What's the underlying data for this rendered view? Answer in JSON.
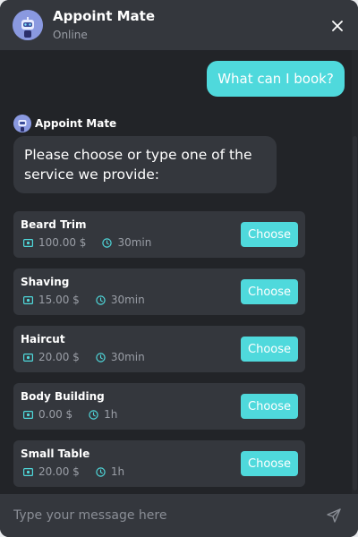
{
  "header": {
    "title": "Appoint Mate",
    "status": "Online",
    "avatar_icon": "robot-avatar-icon",
    "close_icon": "close-icon"
  },
  "messages": {
    "user_message": "What can I book?",
    "bot_name": "Appoint Mate",
    "bot_message": "Please choose or type one of the service we provide:"
  },
  "services": [
    {
      "name": "Beard Trim",
      "price": "100.00 $",
      "duration": "30min",
      "button": "Choose"
    },
    {
      "name": "Shaving",
      "price": "15.00 $",
      "duration": "30min",
      "button": "Choose"
    },
    {
      "name": "Haircut",
      "price": "20.00 $",
      "duration": "30min",
      "button": "Choose"
    },
    {
      "name": "Body Building",
      "price": "0.00 $",
      "duration": "1h",
      "button": "Choose"
    },
    {
      "name": "Small Table",
      "price": "20.00 $",
      "duration": "1h",
      "button": "Choose"
    }
  ],
  "input": {
    "placeholder": "Type your message here",
    "send_icon": "send-icon"
  },
  "colors": {
    "accent": "#4fd9dc",
    "background": "#222428",
    "panel": "#34373d",
    "muted_text": "#9a9ea6"
  }
}
